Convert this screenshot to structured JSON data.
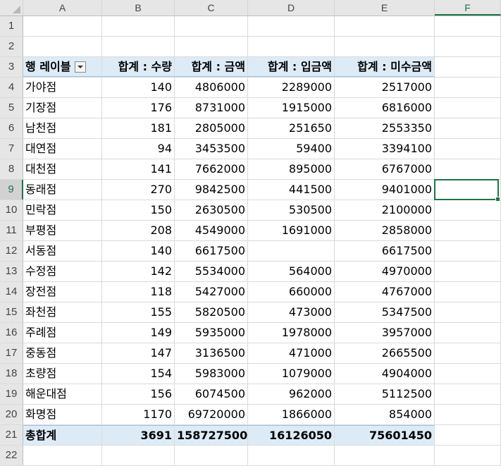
{
  "columns": [
    "A",
    "B",
    "C",
    "D",
    "E",
    "F"
  ],
  "selected_column": "F",
  "selected_row": "9",
  "pivot": {
    "header_row": "3",
    "headers": [
      "행 레이블",
      "합계 : 수량",
      "합계 : 금액",
      "합계 : 입금액",
      "합계 : 미수금액"
    ],
    "rows": [
      {
        "num": "4",
        "label": "가야점",
        "qty": "140",
        "amount": "4806000",
        "paid": "2289000",
        "due": "2517000"
      },
      {
        "num": "5",
        "label": "기장점",
        "qty": "176",
        "amount": "8731000",
        "paid": "1915000",
        "due": "6816000"
      },
      {
        "num": "6",
        "label": "남천점",
        "qty": "181",
        "amount": "2805000",
        "paid": "251650",
        "due": "2553350"
      },
      {
        "num": "7",
        "label": "대연점",
        "qty": "94",
        "amount": "3453500",
        "paid": "59400",
        "due": "3394100"
      },
      {
        "num": "8",
        "label": "대천점",
        "qty": "141",
        "amount": "7662000",
        "paid": "895000",
        "due": "6767000"
      },
      {
        "num": "9",
        "label": "동래점",
        "qty": "270",
        "amount": "9842500",
        "paid": "441500",
        "due": "9401000"
      },
      {
        "num": "10",
        "label": "민락점",
        "qty": "150",
        "amount": "2630500",
        "paid": "530500",
        "due": "2100000"
      },
      {
        "num": "11",
        "label": "부평점",
        "qty": "208",
        "amount": "4549000",
        "paid": "1691000",
        "due": "2858000"
      },
      {
        "num": "12",
        "label": "서동점",
        "qty": "140",
        "amount": "6617500",
        "paid": "",
        "due": "6617500"
      },
      {
        "num": "13",
        "label": "수정점",
        "qty": "142",
        "amount": "5534000",
        "paid": "564000",
        "due": "4970000"
      },
      {
        "num": "14",
        "label": "장전점",
        "qty": "118",
        "amount": "5427000",
        "paid": "660000",
        "due": "4767000"
      },
      {
        "num": "15",
        "label": "좌천점",
        "qty": "155",
        "amount": "5820500",
        "paid": "473000",
        "due": "5347500"
      },
      {
        "num": "16",
        "label": "주례점",
        "qty": "149",
        "amount": "5935000",
        "paid": "1978000",
        "due": "3957000"
      },
      {
        "num": "17",
        "label": "중동점",
        "qty": "147",
        "amount": "3136500",
        "paid": "471000",
        "due": "2665500"
      },
      {
        "num": "18",
        "label": "초량점",
        "qty": "154",
        "amount": "5983000",
        "paid": "1079000",
        "due": "4904000"
      },
      {
        "num": "19",
        "label": "해운대점",
        "qty": "156",
        "amount": "6074500",
        "paid": "962000",
        "due": "5112500"
      },
      {
        "num": "20",
        "label": "화명점",
        "qty": "1170",
        "amount": "69720000",
        "paid": "1866000",
        "due": "854000"
      }
    ],
    "total": {
      "num": "21",
      "label": "총합계",
      "qty": "3691",
      "amount": "158727500",
      "paid": "16126050",
      "due": "75601450"
    }
  },
  "empty_rows_top": [
    "1",
    "2"
  ],
  "empty_rows_bottom": [
    "22"
  ]
}
